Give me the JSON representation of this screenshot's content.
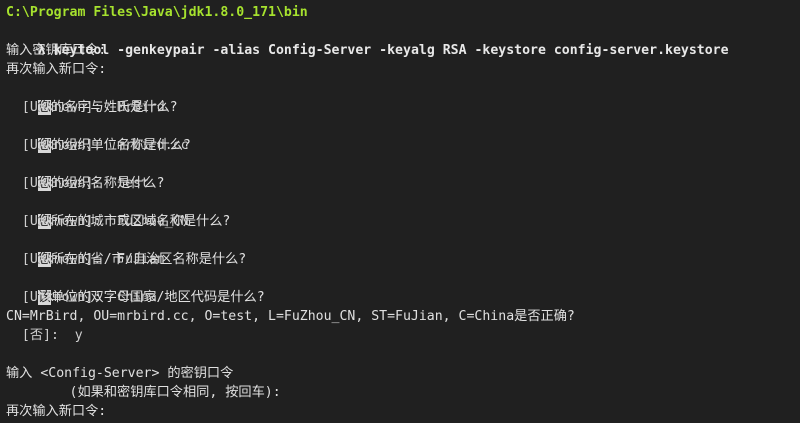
{
  "terminal": {
    "prompt_path": "C:\\Program Files\\Java\\jdk1.8.0_171\\bin",
    "prompt_symbol": "λ",
    "command": " keytool -genkeypair -alias Config-Server -keyalg RSA -keystore config-server.keystore",
    "lines": {
      "l1": "输入密钥库口令:",
      "l2": "再次输入新口令:",
      "q1_mark": "您",
      "q1_rest": "的名字与姓氏是什么?",
      "a1": "  [Unknown]:  MrBird",
      "q2_mark": "您",
      "q2_rest": "的组织单位名称是什么?",
      "a2": "  [Unknown]:  mrbird.cc",
      "q3_mark": "您",
      "q3_rest": "的组织名称是什么?",
      "a3": "  [Unknown]:  test",
      "q4_mark": "您",
      "q4_rest": "所在的城市或区域名称是什么?",
      "a4": "  [Unknown]:  FuZhou_CN",
      "q5_mark": "您",
      "q5_rest": "所在的省/市/自治区名称是什么?",
      "a5": "  [Unknown]:  FuJian",
      "q6_mark": "该",
      "q6_rest": "单位的双字母国家/地区代码是什么?",
      "a6": "  [Unknown]:  China",
      "confirm": "CN=MrBird, OU=mrbird.cc, O=test, L=FuZhou_CN, ST=FuJian, C=China是否正确?",
      "confirm_answer": "  [否]:  y",
      "blank": "",
      "keypass_prompt": "输入 <Config-Server> 的密钥口令",
      "keypass_hint": "        (如果和密钥库口令相同, 按回车):",
      "reenter": "再次输入新口令:"
    }
  }
}
